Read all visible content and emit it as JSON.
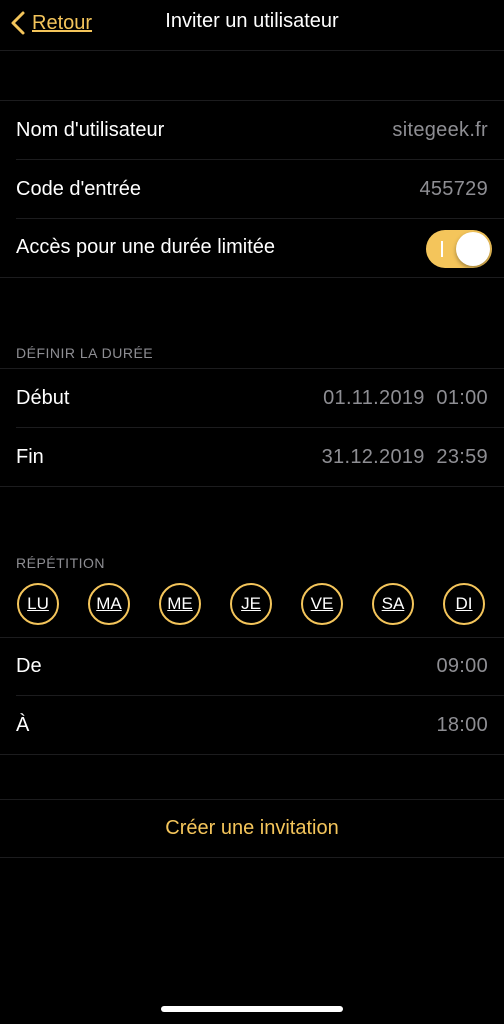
{
  "nav": {
    "back_label": "Retour",
    "title": "Inviter un utilisateur"
  },
  "user": {
    "username_label": "Nom d'utilisateur",
    "username_value": "sitegeek.fr",
    "code_label": "Code d'entrée",
    "code_value": "455729",
    "limited_label": "Accès pour une durée limitée",
    "limited_enabled": true
  },
  "duration": {
    "header": "DÉFINIR LA DURÉE",
    "start_label": "Début",
    "start_value": "01.11.2019  01:00",
    "end_label": "Fin",
    "end_value": "31.12.2019  23:59"
  },
  "repetition": {
    "header": "RÉPÉTITION",
    "days": [
      "LU",
      "MA",
      "ME",
      "JE",
      "VE",
      "SA",
      "DI"
    ],
    "from_label": "De",
    "from_value": "09:00",
    "to_label": "À",
    "to_value": "18:00"
  },
  "actions": {
    "create_label": "Créer une invitation"
  },
  "colors": {
    "accent": "#f4c55b",
    "background": "#000000",
    "secondary_text": "#8e8e93"
  },
  "icons": {
    "back": "chevron-left-icon"
  }
}
